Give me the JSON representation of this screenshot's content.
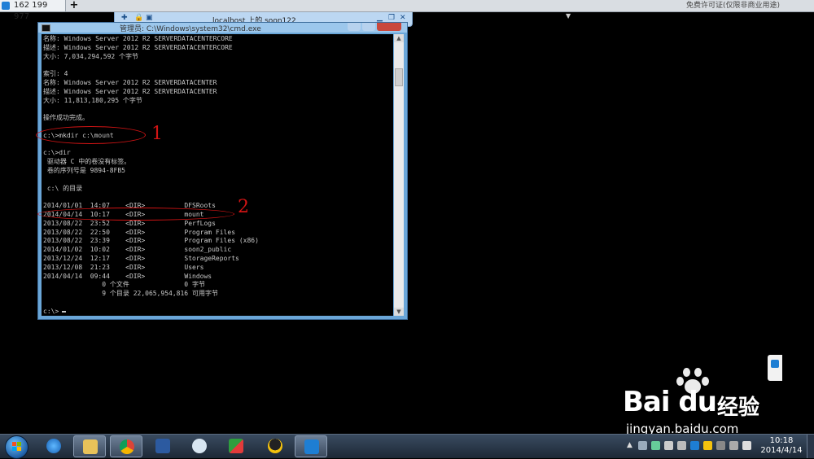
{
  "remote_tab": {
    "label": "162 199 977",
    "plus": "+",
    "free_notice": "免费许可证(仅限非商业用途)"
  },
  "remote_toolbar": {
    "title": "localhost 上的 soon122"
  },
  "cmd_window": {
    "title": "管理员: C:\\Windows\\system32\\cmd.exe",
    "lines": [
      "名称: Windows Server 2012 R2 SERVERDATACENTERCORE",
      "描述: Windows Server 2012 R2 SERVERDATACENTERCORE",
      "大小: 7,034,294,592 个字节",
      "",
      "索引: 4",
      "名称: Windows Server 2012 R2 SERVERDATACENTER",
      "描述: Windows Server 2012 R2 SERVERDATACENTER",
      "大小: 11,813,180,295 个字节",
      "",
      "操作成功完成。",
      "",
      "c:\\>mkdir c:\\mount",
      "",
      "c:\\>dir",
      " 驱动器 C 中的卷没有标签。",
      " 卷的序列号是 9894-8FB5",
      "",
      " c:\\ 的目录",
      "",
      "2014/01/01  14:07    <DIR>          DFSRoots",
      "2014/04/14  10:17    <DIR>          mount",
      "2013/08/22  23:52    <DIR>          PerfLogs",
      "2013/08/22  22:50    <DIR>          Program Files",
      "2013/08/22  23:39    <DIR>          Program Files (x86)",
      "2014/01/02  10:02    <DIR>          soon2_public",
      "2013/12/24  12:17    <DIR>          StorageReports",
      "2013/12/08  21:23    <DIR>          Users",
      "2014/04/14  09:44    <DIR>          Windows",
      "               0 个文件              0 字节",
      "               9 个目录 22,065,954,816 可用字节",
      "",
      "c:\\>"
    ]
  },
  "annotations": {
    "one": "1",
    "two": "2"
  },
  "watermark": {
    "brand": "Bai du",
    "product": "经验",
    "url": "jingyan.baidu.com"
  },
  "taskbar": {
    "time": "10:18",
    "date": "2014/4/14",
    "apps": [
      "ie-icon",
      "explorer-icon",
      "chrome-icon",
      "powershell-icon",
      "search-tool-icon",
      "app-icon",
      "qq-icon",
      "teamviewer-icon"
    ]
  },
  "colors": {
    "terminal_bg": "#000000",
    "terminal_fg": "#c8c8c8",
    "annotation": "#d21414"
  }
}
